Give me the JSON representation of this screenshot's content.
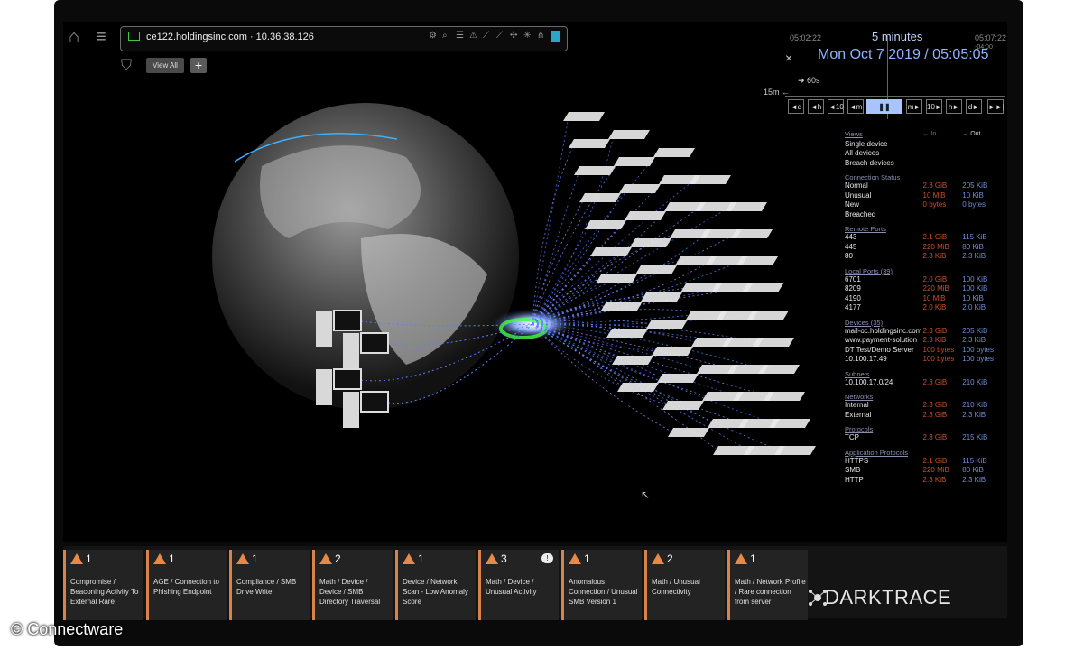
{
  "address_bar": {
    "host": "ce122.holdingsinc.com · 10.36.38.126"
  },
  "toolbar": {
    "view_all_label": "View All",
    "add_label": "+"
  },
  "icons": {
    "home": "home-icon",
    "menu": "hamburger-icon",
    "tag": "tag-icon"
  },
  "timeline": {
    "left_time": "05:02:22",
    "duration": "5 minutes",
    "right_time": "05:07:22",
    "offset": "-04:00",
    "date": "Mon Oct 7 2019 / 05:05:05",
    "close_label": "×",
    "step_label": "➜ 60s",
    "range_label": "15m ←",
    "buttons": [
      "◄d",
      "◄h",
      "◄10",
      "◄m",
      "❚❚",
      "m►",
      "10►",
      "h►",
      "d►",
      "►►|"
    ]
  },
  "stats": {
    "views": {
      "title": "Views",
      "in_label": "← In",
      "out_label": "→ Out",
      "items": [
        "Single device",
        "All devices",
        "Breach devices"
      ]
    },
    "sections": [
      {
        "title": "Connection Status",
        "rows": [
          [
            "Normal",
            "2.3 GiB",
            "205 KiB"
          ],
          [
            "Unusual",
            "10 MiB",
            "10 KiB"
          ],
          [
            "New",
            "0 bytes",
            "0 bytes"
          ],
          [
            "Breached",
            "",
            ""
          ]
        ]
      },
      {
        "title": "Remote Ports",
        "rows": [
          [
            "443",
            "2.1 GiB",
            "115 KiB"
          ],
          [
            "445",
            "220 MiB",
            "80 KiB"
          ],
          [
            "80",
            "2.3 KiB",
            "2.3 KiB"
          ]
        ]
      },
      {
        "title": "Local Ports (39)",
        "rows": [
          [
            "6701",
            "2.0 GiB",
            "100 KiB"
          ],
          [
            "8209",
            "220 MiB",
            "100 KiB"
          ],
          [
            "4190",
            "10 MiB",
            "10 KiB"
          ],
          [
            "4177",
            "2.0 KiB",
            "2.0 KiB"
          ]
        ]
      },
      {
        "title": "Devices (35)",
        "rows": [
          [
            "mail-oc.holdingsinc.com",
            "2.3 GiB",
            "205 KiB"
          ],
          [
            "www.payment-solution",
            "2.3 KiB",
            "2.3 KiB"
          ],
          [
            "DT Test/Demo Server",
            "100 bytes",
            "100 bytes"
          ],
          [
            "10.100.17.49",
            "100 bytes",
            "100 bytes"
          ]
        ]
      },
      {
        "title": "Subnets",
        "rows": [
          [
            "10.100.17.0/24",
            "2.3 GiB",
            "210 KiB"
          ]
        ]
      },
      {
        "title": "Networks",
        "rows": [
          [
            "Internal",
            "2.3 GiB",
            "210 KiB"
          ],
          [
            "External",
            "2.3 GiB",
            "2.3 KiB"
          ]
        ]
      },
      {
        "title": "Protocols",
        "rows": [
          [
            "TCP",
            "2.3 GiB",
            "215 KiB"
          ]
        ]
      },
      {
        "title": "Application Protocols",
        "rows": [
          [
            "HTTPS",
            "2.1 GiB",
            "115 KiB"
          ],
          [
            "SMB",
            "220 MiB",
            "80 KiB"
          ],
          [
            "HTTP",
            "2.3 KiB",
            "2.3 KiB"
          ]
        ]
      }
    ]
  },
  "alerts": [
    {
      "count": "1",
      "text": "Compromise / Beaconing Activity To External Rare"
    },
    {
      "count": "1",
      "text": "AGE / Connection to Phishing Endpoint"
    },
    {
      "count": "1",
      "text": "Compliance / SMB Drive Write"
    },
    {
      "count": "2",
      "text": "Math / Device / Device / SMB Directory Traversal"
    },
    {
      "count": "1",
      "text": "Device / Network Scan - Low Anomaly Score"
    },
    {
      "count": "3",
      "text": "Math / Device / Unusual Activity"
    },
    {
      "count": "1",
      "text": "Anomalous Connection / Unusual SMB Version 1"
    },
    {
      "count": "2",
      "text": "Math / Unusual Connectivity"
    },
    {
      "count": "1",
      "text": "Math / Network Profile / Rare connection from server"
    }
  ],
  "chat_badge": "!",
  "brand": {
    "name": "DARKTRACE"
  },
  "copyright": "© Connectware",
  "colors": {
    "accent": "#a8c4ff",
    "alert": "#e58a4a",
    "in": "#c9502a",
    "out": "#6e8ed8"
  }
}
